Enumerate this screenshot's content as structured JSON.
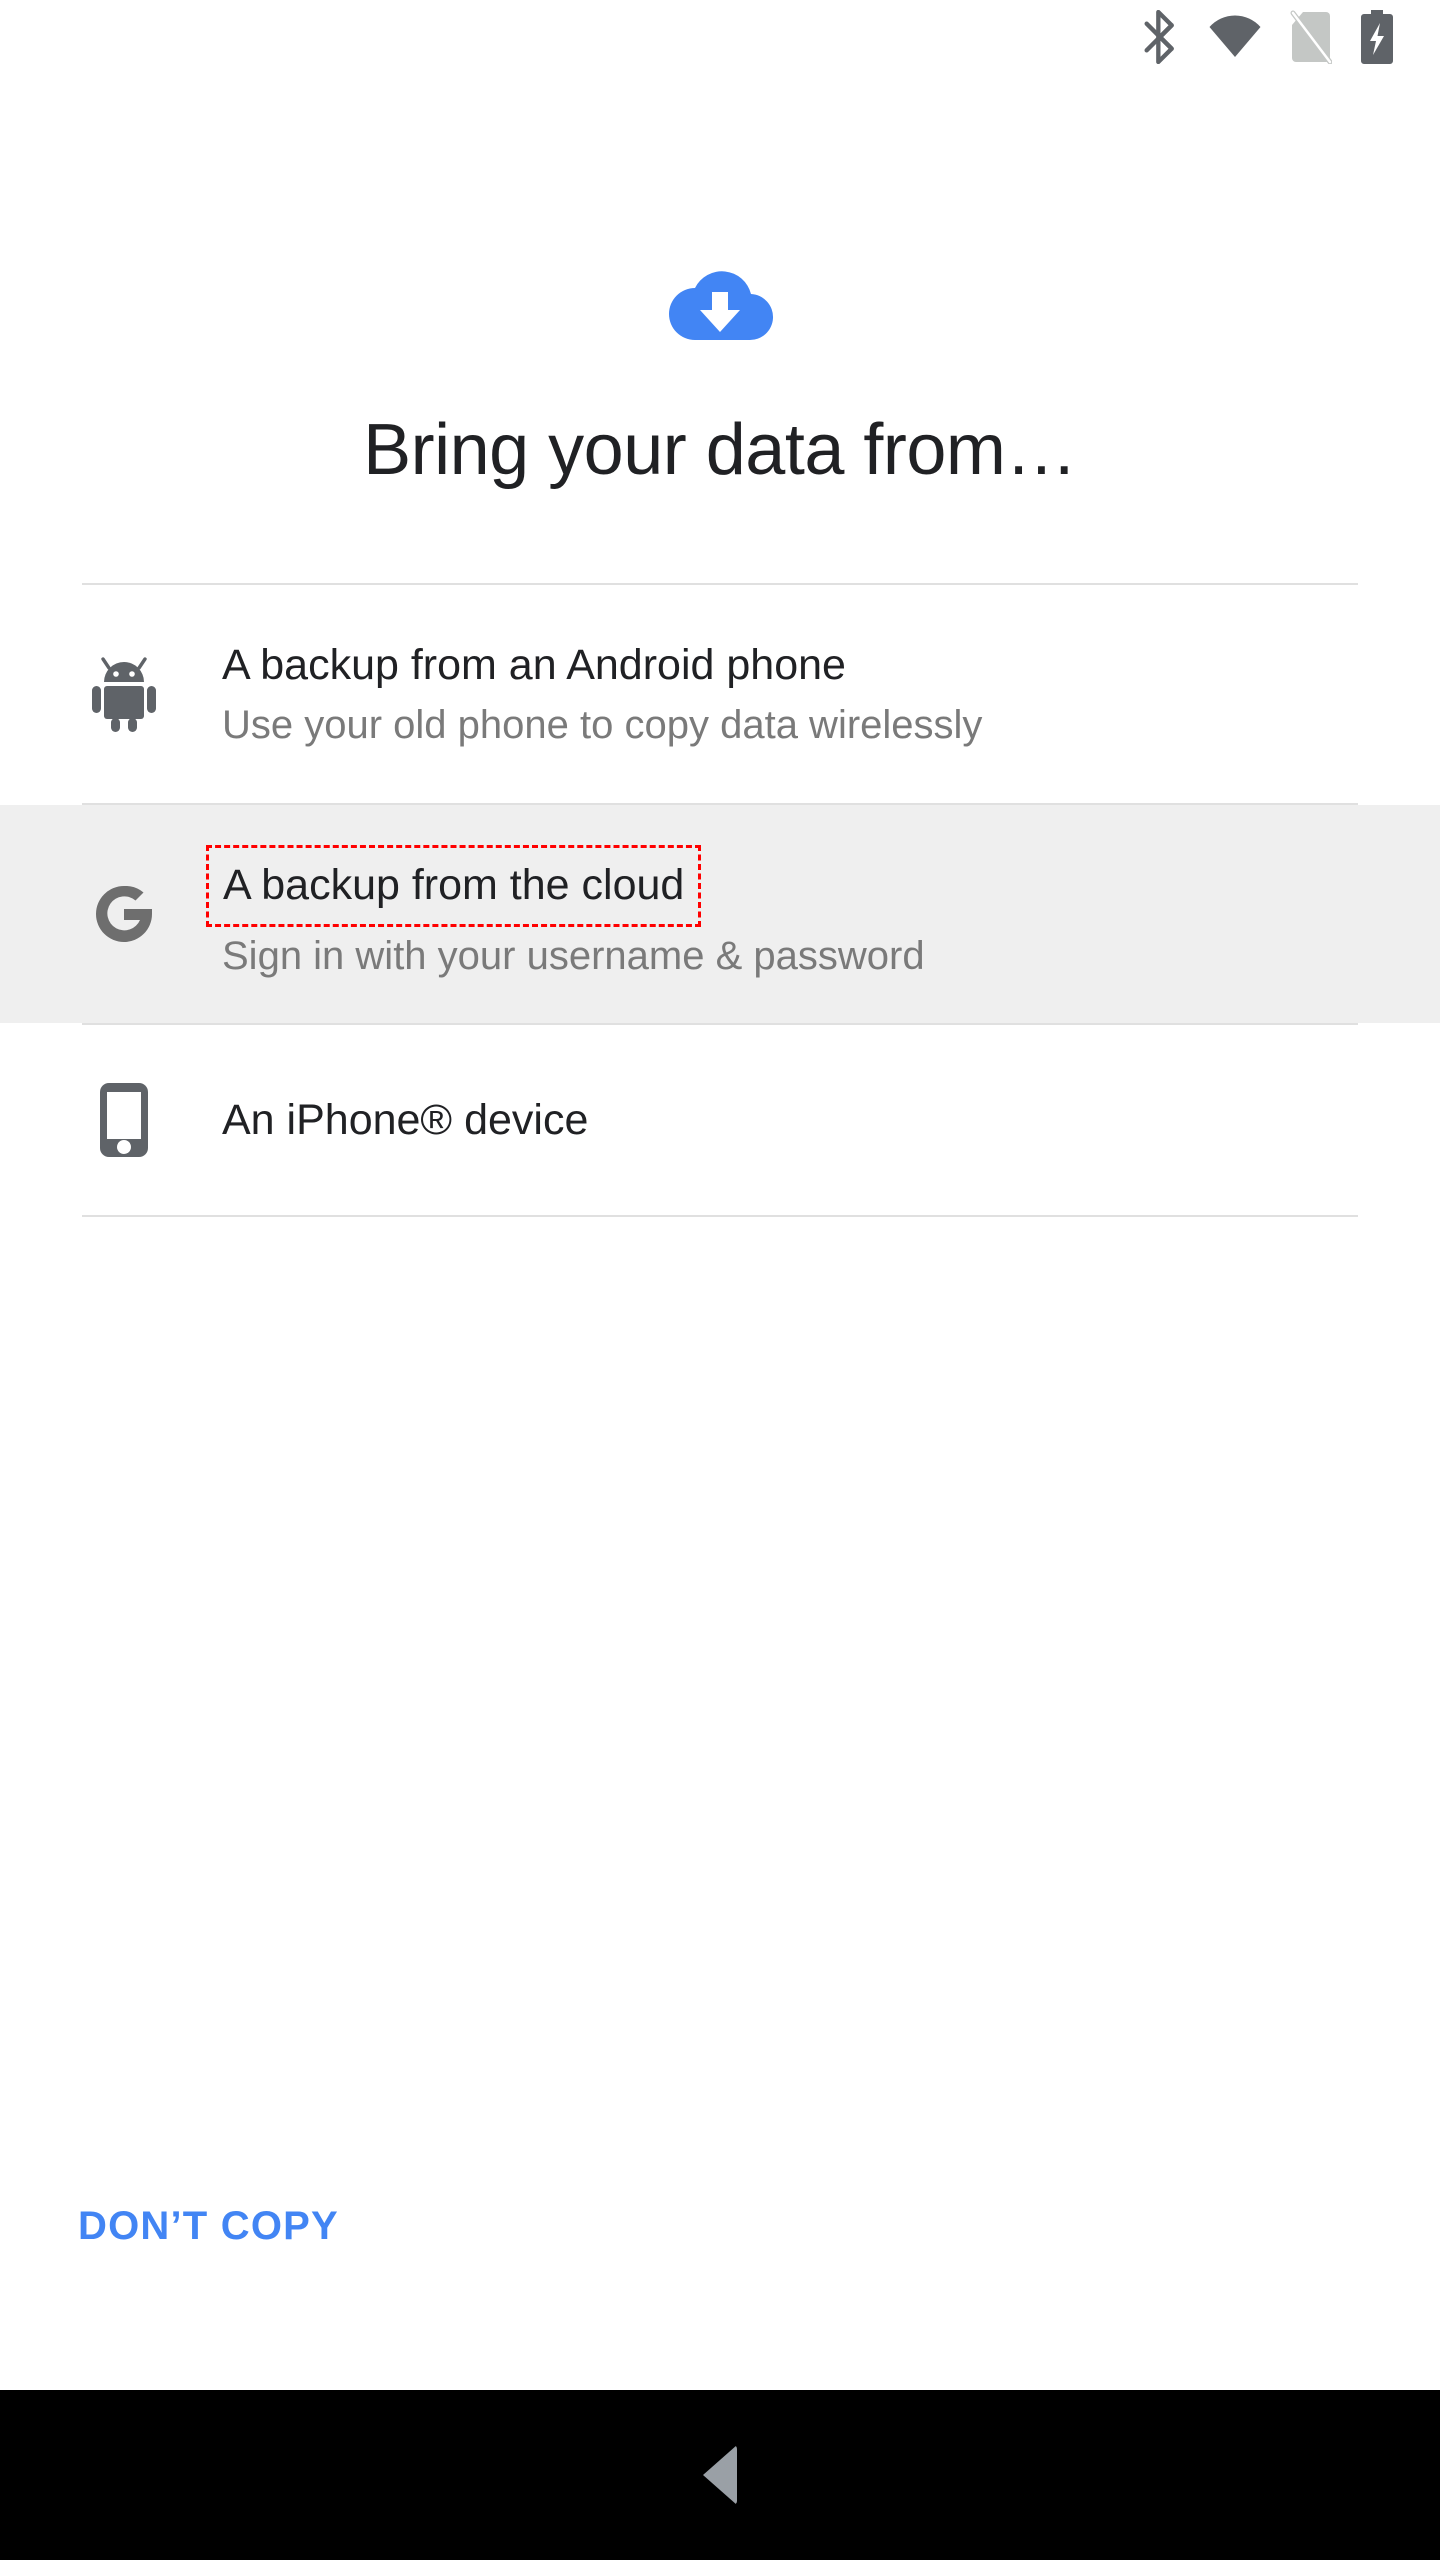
{
  "status_bar": {
    "icons": [
      {
        "name": "bluetooth-icon",
        "label": "Bluetooth"
      },
      {
        "name": "wifi-icon",
        "label": "Wi-Fi full signal"
      },
      {
        "name": "no-sim-icon",
        "label": "No SIM card"
      },
      {
        "name": "battery-charging-icon",
        "label": "Battery charging"
      }
    ]
  },
  "hero": {
    "icon": "cloud-download-icon",
    "accent_color": "#4285f4"
  },
  "header": {
    "title": "Bring your data from…"
  },
  "options": [
    {
      "icon": "android-robot-icon",
      "title": "A backup from an Android phone",
      "subtitle": "Use your old phone to copy data wirelessly",
      "highlighted": false,
      "annotated": false
    },
    {
      "icon": "google-g-icon",
      "title": "A backup from the cloud",
      "subtitle": "Sign in with your username & password",
      "highlighted": true,
      "annotated": true
    },
    {
      "icon": "iphone-device-icon",
      "title": "An iPhone® device",
      "subtitle": "",
      "highlighted": false,
      "annotated": false
    }
  ],
  "footer": {
    "dont_copy_label": "DON’T COPY",
    "link_color": "#4285f4"
  },
  "nav_bar": {
    "back_label": "Back",
    "background_color": "#000000",
    "icon_color": "#9aa0a6"
  },
  "annotation": {
    "color": "#ff0000",
    "style": "dashed",
    "target": "A backup from the cloud"
  }
}
